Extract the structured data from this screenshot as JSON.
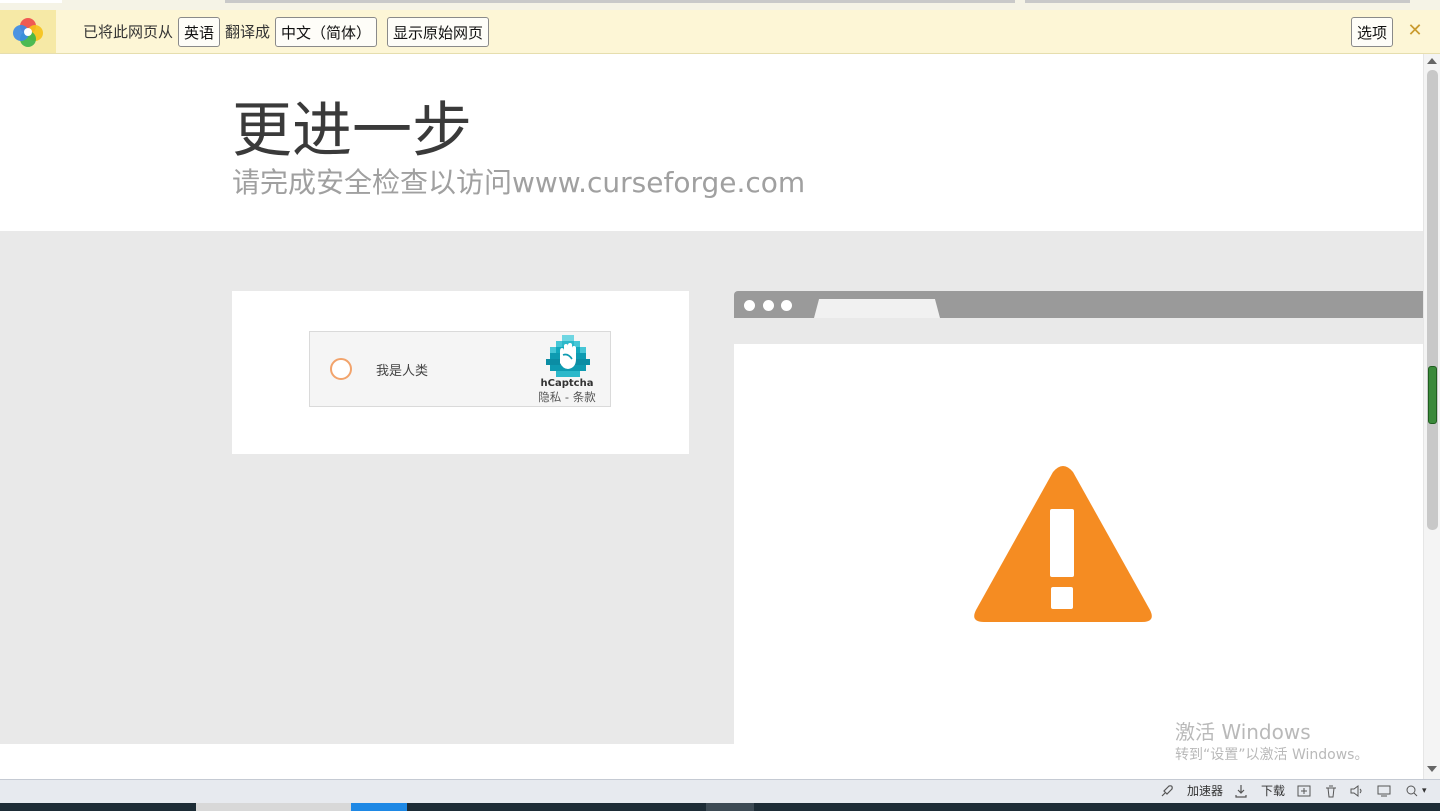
{
  "translate_bar": {
    "prefix_text": "已将此网页从",
    "source_language": "英语",
    "middle_text": "翻译成",
    "target_language": "中文（简体）",
    "show_original_label": "显示原始网页",
    "options_label": "选项",
    "close_glyph": "✕"
  },
  "page": {
    "title": "更进一步",
    "subtitle": "请完成安全检查以访问www.curseforge.com"
  },
  "hcaptcha": {
    "checkbox_label": "我是人类",
    "brand": "hCaptcha",
    "links": "隐私 - 条款"
  },
  "warning": {
    "icon": "warning-triangle-icon",
    "color": "#f58c22"
  },
  "watermark": {
    "line1": "激活 Windows",
    "line2": "转到“设置”以激活 Windows。"
  },
  "status_bar": {
    "accelerator_label": "加速器",
    "download_label": "下载"
  },
  "colors": {
    "translate_bar_bg": "#fdf6d6",
    "content_bg": "#e9e9e9",
    "browser_chrome": "#9a9a9a",
    "checkbox_ring": "#f2a36b",
    "hcaptcha_teal": "#0fb1c4"
  }
}
